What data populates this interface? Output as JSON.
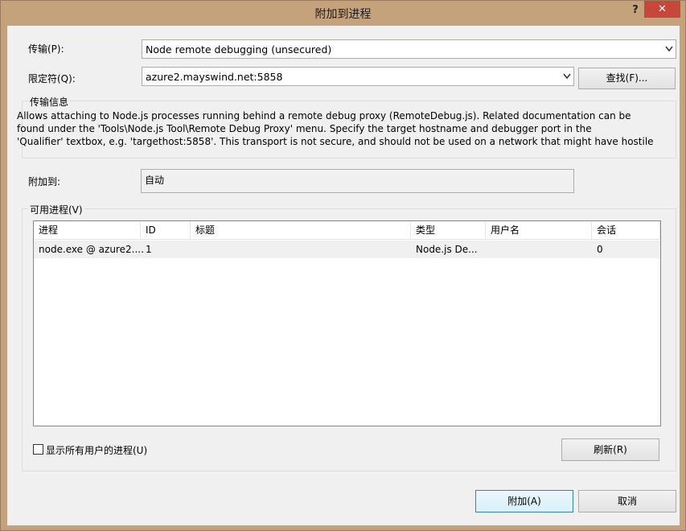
{
  "window": {
    "title": "附加到进程",
    "help": "?",
    "close": "✕"
  },
  "transport": {
    "label": "传输(P):",
    "value": "Node remote debugging (unsecured)"
  },
  "qualifier": {
    "label": "限定符(Q):",
    "value": "azure2.mayswind.net:5858",
    "find_button": "查找(F)..."
  },
  "transport_info": {
    "title": "传输信息",
    "lines": [
      "Allows attaching to Node.js processes running behind a remote debug proxy (RemoteDebug.js). Related documentation can be",
      "found under the 'Tools\\Node.js Tool\\Remote Debug Proxy' menu. Specify the target hostname and debugger port in the",
      "'Qualifier' textbox, e.g. 'targethost:5858'. This transport is not secure, and should not be used on a network that might have hostile"
    ]
  },
  "attach_to": {
    "label": "附加到:",
    "value": "自动"
  },
  "processes": {
    "title": "可用进程(V)",
    "columns": [
      "进程",
      "ID",
      "标题",
      "类型",
      "用户名",
      "会话"
    ],
    "rows": [
      [
        "node.exe @ azure2....",
        "1",
        "",
        "Node.js De...",
        "",
        "0"
      ]
    ],
    "show_all_label": "显示所有用户的进程(U)",
    "show_all_checked": false,
    "refresh_button": "刷新(R)"
  },
  "footer": {
    "attach_button": "附加(A)",
    "cancel_button": "取消"
  }
}
